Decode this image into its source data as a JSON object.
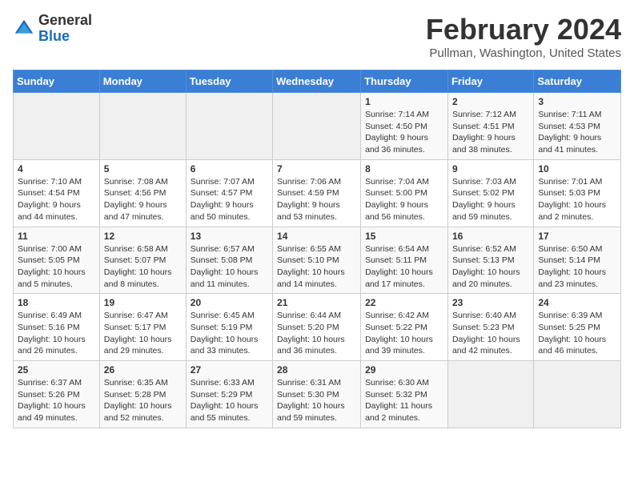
{
  "header": {
    "logo_general": "General",
    "logo_blue": "Blue",
    "month_title": "February 2024",
    "location": "Pullman, Washington, United States"
  },
  "weekdays": [
    "Sunday",
    "Monday",
    "Tuesday",
    "Wednesday",
    "Thursday",
    "Friday",
    "Saturday"
  ],
  "weeks": [
    [
      {
        "day": "",
        "info": ""
      },
      {
        "day": "",
        "info": ""
      },
      {
        "day": "",
        "info": ""
      },
      {
        "day": "",
        "info": ""
      },
      {
        "day": "1",
        "info": "Sunrise: 7:14 AM\nSunset: 4:50 PM\nDaylight: 9 hours and 36 minutes."
      },
      {
        "day": "2",
        "info": "Sunrise: 7:12 AM\nSunset: 4:51 PM\nDaylight: 9 hours and 38 minutes."
      },
      {
        "day": "3",
        "info": "Sunrise: 7:11 AM\nSunset: 4:53 PM\nDaylight: 9 hours and 41 minutes."
      }
    ],
    [
      {
        "day": "4",
        "info": "Sunrise: 7:10 AM\nSunset: 4:54 PM\nDaylight: 9 hours and 44 minutes."
      },
      {
        "day": "5",
        "info": "Sunrise: 7:08 AM\nSunset: 4:56 PM\nDaylight: 9 hours and 47 minutes."
      },
      {
        "day": "6",
        "info": "Sunrise: 7:07 AM\nSunset: 4:57 PM\nDaylight: 9 hours and 50 minutes."
      },
      {
        "day": "7",
        "info": "Sunrise: 7:06 AM\nSunset: 4:59 PM\nDaylight: 9 hours and 53 minutes."
      },
      {
        "day": "8",
        "info": "Sunrise: 7:04 AM\nSunset: 5:00 PM\nDaylight: 9 hours and 56 minutes."
      },
      {
        "day": "9",
        "info": "Sunrise: 7:03 AM\nSunset: 5:02 PM\nDaylight: 9 hours and 59 minutes."
      },
      {
        "day": "10",
        "info": "Sunrise: 7:01 AM\nSunset: 5:03 PM\nDaylight: 10 hours and 2 minutes."
      }
    ],
    [
      {
        "day": "11",
        "info": "Sunrise: 7:00 AM\nSunset: 5:05 PM\nDaylight: 10 hours and 5 minutes."
      },
      {
        "day": "12",
        "info": "Sunrise: 6:58 AM\nSunset: 5:07 PM\nDaylight: 10 hours and 8 minutes."
      },
      {
        "day": "13",
        "info": "Sunrise: 6:57 AM\nSunset: 5:08 PM\nDaylight: 10 hours and 11 minutes."
      },
      {
        "day": "14",
        "info": "Sunrise: 6:55 AM\nSunset: 5:10 PM\nDaylight: 10 hours and 14 minutes."
      },
      {
        "day": "15",
        "info": "Sunrise: 6:54 AM\nSunset: 5:11 PM\nDaylight: 10 hours and 17 minutes."
      },
      {
        "day": "16",
        "info": "Sunrise: 6:52 AM\nSunset: 5:13 PM\nDaylight: 10 hours and 20 minutes."
      },
      {
        "day": "17",
        "info": "Sunrise: 6:50 AM\nSunset: 5:14 PM\nDaylight: 10 hours and 23 minutes."
      }
    ],
    [
      {
        "day": "18",
        "info": "Sunrise: 6:49 AM\nSunset: 5:16 PM\nDaylight: 10 hours and 26 minutes."
      },
      {
        "day": "19",
        "info": "Sunrise: 6:47 AM\nSunset: 5:17 PM\nDaylight: 10 hours and 29 minutes."
      },
      {
        "day": "20",
        "info": "Sunrise: 6:45 AM\nSunset: 5:19 PM\nDaylight: 10 hours and 33 minutes."
      },
      {
        "day": "21",
        "info": "Sunrise: 6:44 AM\nSunset: 5:20 PM\nDaylight: 10 hours and 36 minutes."
      },
      {
        "day": "22",
        "info": "Sunrise: 6:42 AM\nSunset: 5:22 PM\nDaylight: 10 hours and 39 minutes."
      },
      {
        "day": "23",
        "info": "Sunrise: 6:40 AM\nSunset: 5:23 PM\nDaylight: 10 hours and 42 minutes."
      },
      {
        "day": "24",
        "info": "Sunrise: 6:39 AM\nSunset: 5:25 PM\nDaylight: 10 hours and 46 minutes."
      }
    ],
    [
      {
        "day": "25",
        "info": "Sunrise: 6:37 AM\nSunset: 5:26 PM\nDaylight: 10 hours and 49 minutes."
      },
      {
        "day": "26",
        "info": "Sunrise: 6:35 AM\nSunset: 5:28 PM\nDaylight: 10 hours and 52 minutes."
      },
      {
        "day": "27",
        "info": "Sunrise: 6:33 AM\nSunset: 5:29 PM\nDaylight: 10 hours and 55 minutes."
      },
      {
        "day": "28",
        "info": "Sunrise: 6:31 AM\nSunset: 5:30 PM\nDaylight: 10 hours and 59 minutes."
      },
      {
        "day": "29",
        "info": "Sunrise: 6:30 AM\nSunset: 5:32 PM\nDaylight: 11 hours and 2 minutes."
      },
      {
        "day": "",
        "info": ""
      },
      {
        "day": "",
        "info": ""
      }
    ]
  ]
}
